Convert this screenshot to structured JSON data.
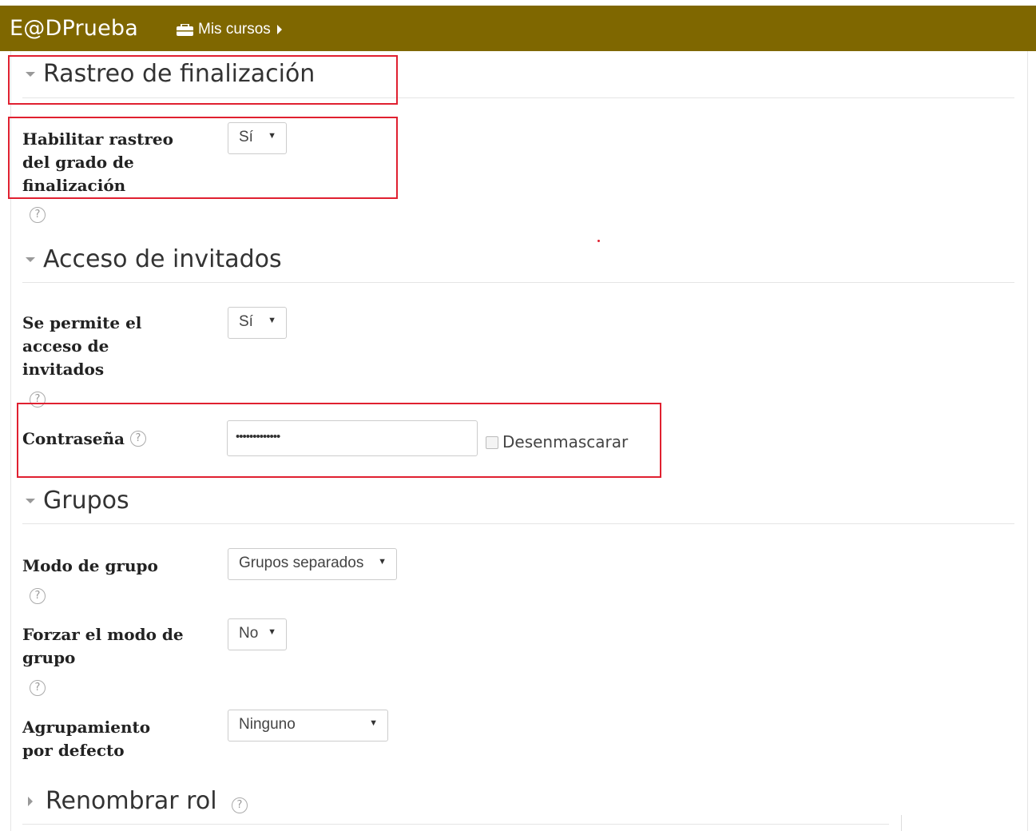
{
  "navbar": {
    "brand": "E@DPrueba",
    "courses_label": "Mis cursos"
  },
  "sections": {
    "completion": {
      "title": "Rastreo de finalización",
      "enable_label": "Habilitar rastreo del grado de finalización",
      "enable_value": "Sí"
    },
    "guest": {
      "title": "Acceso de invitados",
      "allow_label": "Se permite el acceso de invitados",
      "allow_value": "Sí",
      "password_label": "Contraseña",
      "password_value": "•••••••••••••",
      "unmask_label": "Desenmascarar"
    },
    "groups": {
      "title": "Grupos",
      "mode_label": "Modo de grupo",
      "mode_value": "Grupos separados",
      "force_label": "Forzar el modo de grupo",
      "force_value": "No",
      "grouping_label": "Agrupamiento por defecto",
      "grouping_value": "Ninguno"
    },
    "roles": {
      "title": "Renombrar rol"
    }
  },
  "colors": {
    "navbar": "#7f6700",
    "highlight": "#e02030"
  },
  "icons": [
    "briefcase-icon",
    "caret-right-icon",
    "help-icon",
    "collapse-arrow-icon",
    "expand-arrow-icon",
    "dropdown-arrow-icon"
  ]
}
